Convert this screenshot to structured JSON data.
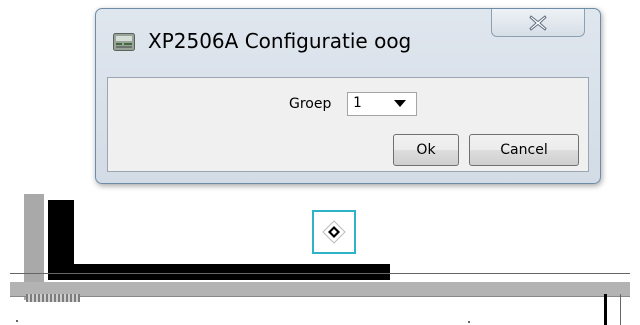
{
  "dialog": {
    "title": "XP2506A Configuratie oog",
    "app_icon": "configuration-card-icon",
    "close_icon": "close-x-icon"
  },
  "form": {
    "groep_label": "Groep",
    "groep_value": "1",
    "dropdown_icon": "chevron-down-icon"
  },
  "buttons": {
    "ok_label": "Ok",
    "cancel_label": "Cancel"
  },
  "canvas": {
    "eye_widget_icon": "eye-diamond-icon",
    "eye_widget_border_color": "#2fb3c8"
  }
}
